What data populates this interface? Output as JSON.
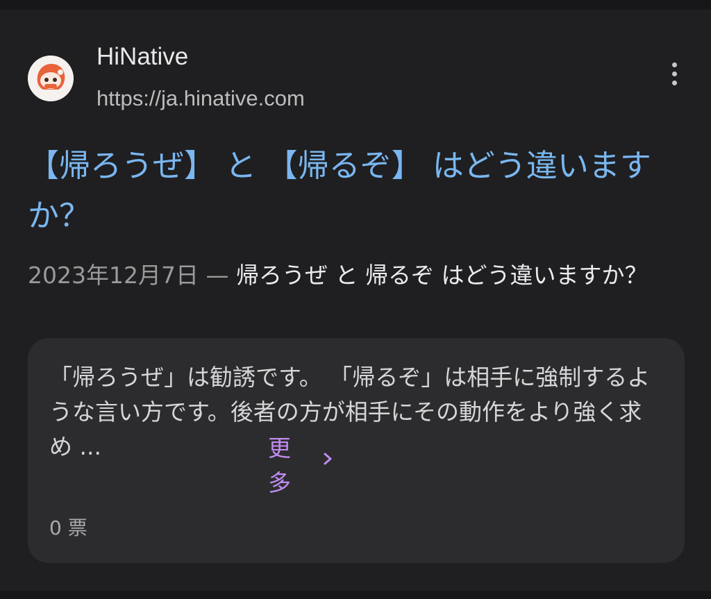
{
  "result": {
    "site_name": "HiNative",
    "site_url": "https://ja.hinative.com",
    "favicon_icon": "hinative-logo-icon",
    "menu_icon": "more-vert-icon",
    "title": "【帰ろうぜ】 と 【帰るぞ】 はどう違いますか？",
    "snippet": {
      "date": "2023年12月7日",
      "separator": " — ",
      "text": "帰ろうぜ と 帰るぞ はどう違いますか？"
    }
  },
  "answer": {
    "text": "「帰ろうぜ」は勧誘です。 「帰るぞ」は相手に強制するような言い方です。後者の方が相手にその動作をより強く求め ...",
    "more_label": "更多",
    "more_icon": "chevron-right-icon",
    "votes": "0 票"
  },
  "colors": {
    "background": "#1f1f21",
    "card": "#2c2c2e",
    "title_link": "#7ab7f0",
    "more_link": "#c08cf0",
    "favicon_accent": "#e8623a"
  }
}
